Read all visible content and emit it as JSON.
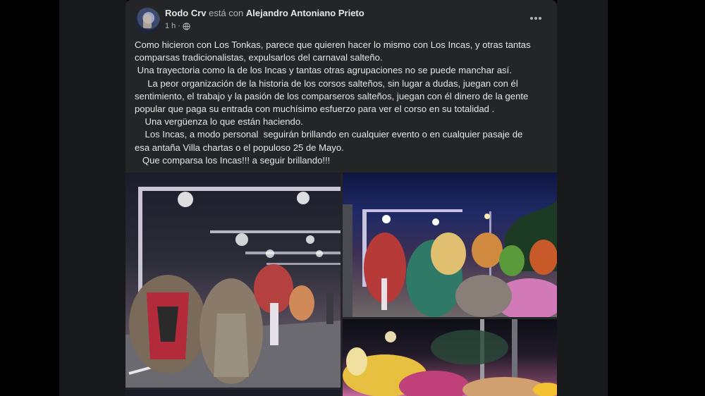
{
  "post": {
    "author": "Rodo Crv",
    "connector": "está con",
    "tagged": "Alejandro Antoniano Prieto",
    "time": "1 h",
    "privacy_icon": "globe-icon",
    "more_icon": "more-options-icon",
    "text_lines": [
      "Como hicieron con Los Tonkas, parece que quieren hacer lo mismo con Los Incas, y otras tantas",
      "comparsas tradicionalistas, expulsarlos del carnaval salteño.",
      " Una trayectoria como la de los Incas y tantas otras agrupaciones no se puede manchar así.",
      "     La peor organización de la historia de los corsos salteños, sin lugar a dudas, juegan con él",
      "sentimiento, el trabajo y la pasión de los comparseros salteños, juegan con él dinero de la gente",
      "popular que paga su entrada con muchísimo esfuerzo para ver el corso en su totalidad .",
      "    Una vergüenza lo que están haciendo.",
      "    Los Incas, a modo personal  seguirán brillando en cualquier evento o en cualquier pasaje de",
      "esa antaña Villa chartas o el populoso 25 de Mayo.",
      "   Que comparsa los Incas!!! a seguir brillando!!!"
    ]
  },
  "photos": [
    {
      "name": "carnival-photo-1"
    },
    {
      "name": "carnival-photo-2"
    },
    {
      "name": "carnival-photo-3"
    },
    {
      "name": "carnival-photo-4"
    }
  ],
  "colors": {
    "card_bg": "#242526",
    "text_primary": "#e4e6eb",
    "text_secondary": "#b0b3b8",
    "page_bg": "#18191a"
  }
}
